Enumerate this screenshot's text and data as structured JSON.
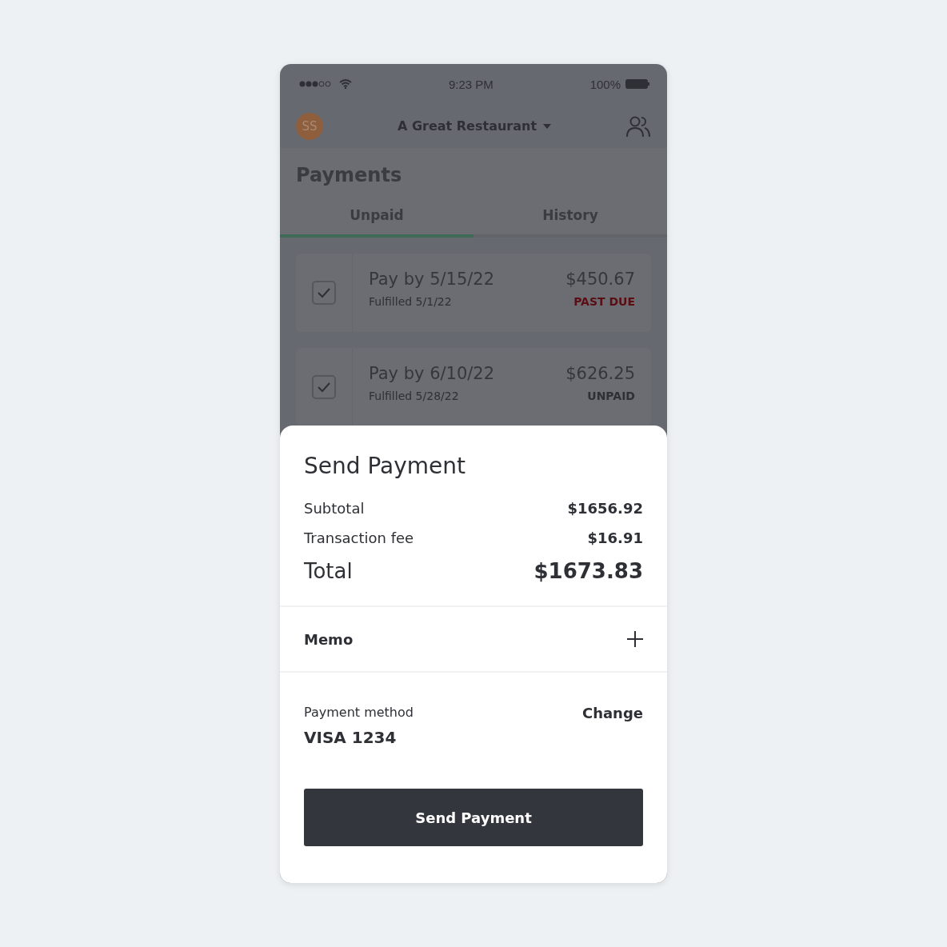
{
  "status_bar": {
    "time": "9:23 PM",
    "battery": "100%"
  },
  "header": {
    "avatar": "SS",
    "restaurant": "A Great Restaurant"
  },
  "page_title": "Payments",
  "tabs": [
    {
      "label": "Unpaid",
      "selected": true
    },
    {
      "label": "History",
      "selected": false
    }
  ],
  "invoices": [
    {
      "title": "Pay by 5/15/22",
      "subtitle": "Fulfilled 5/1/22",
      "amount": "$450.67",
      "status": "PAST DUE",
      "kind": "past_due",
      "checked": true
    },
    {
      "title": "Pay by 6/10/22",
      "subtitle": "Fulfilled 5/28/22",
      "amount": "$626.25",
      "status": "UNPAID",
      "kind": "unpaid",
      "checked": true
    }
  ],
  "sheet": {
    "title": "Send Payment",
    "subtotal_label": "Subtotal",
    "subtotal": "$1656.92",
    "fee_label": "Transaction fee",
    "fee": "$16.91",
    "total_label": "Total",
    "total": "$1673.83",
    "memo": "Memo",
    "method_label": "Payment method",
    "method": "VISA 1234",
    "change": "Change",
    "button": "Send Payment"
  }
}
